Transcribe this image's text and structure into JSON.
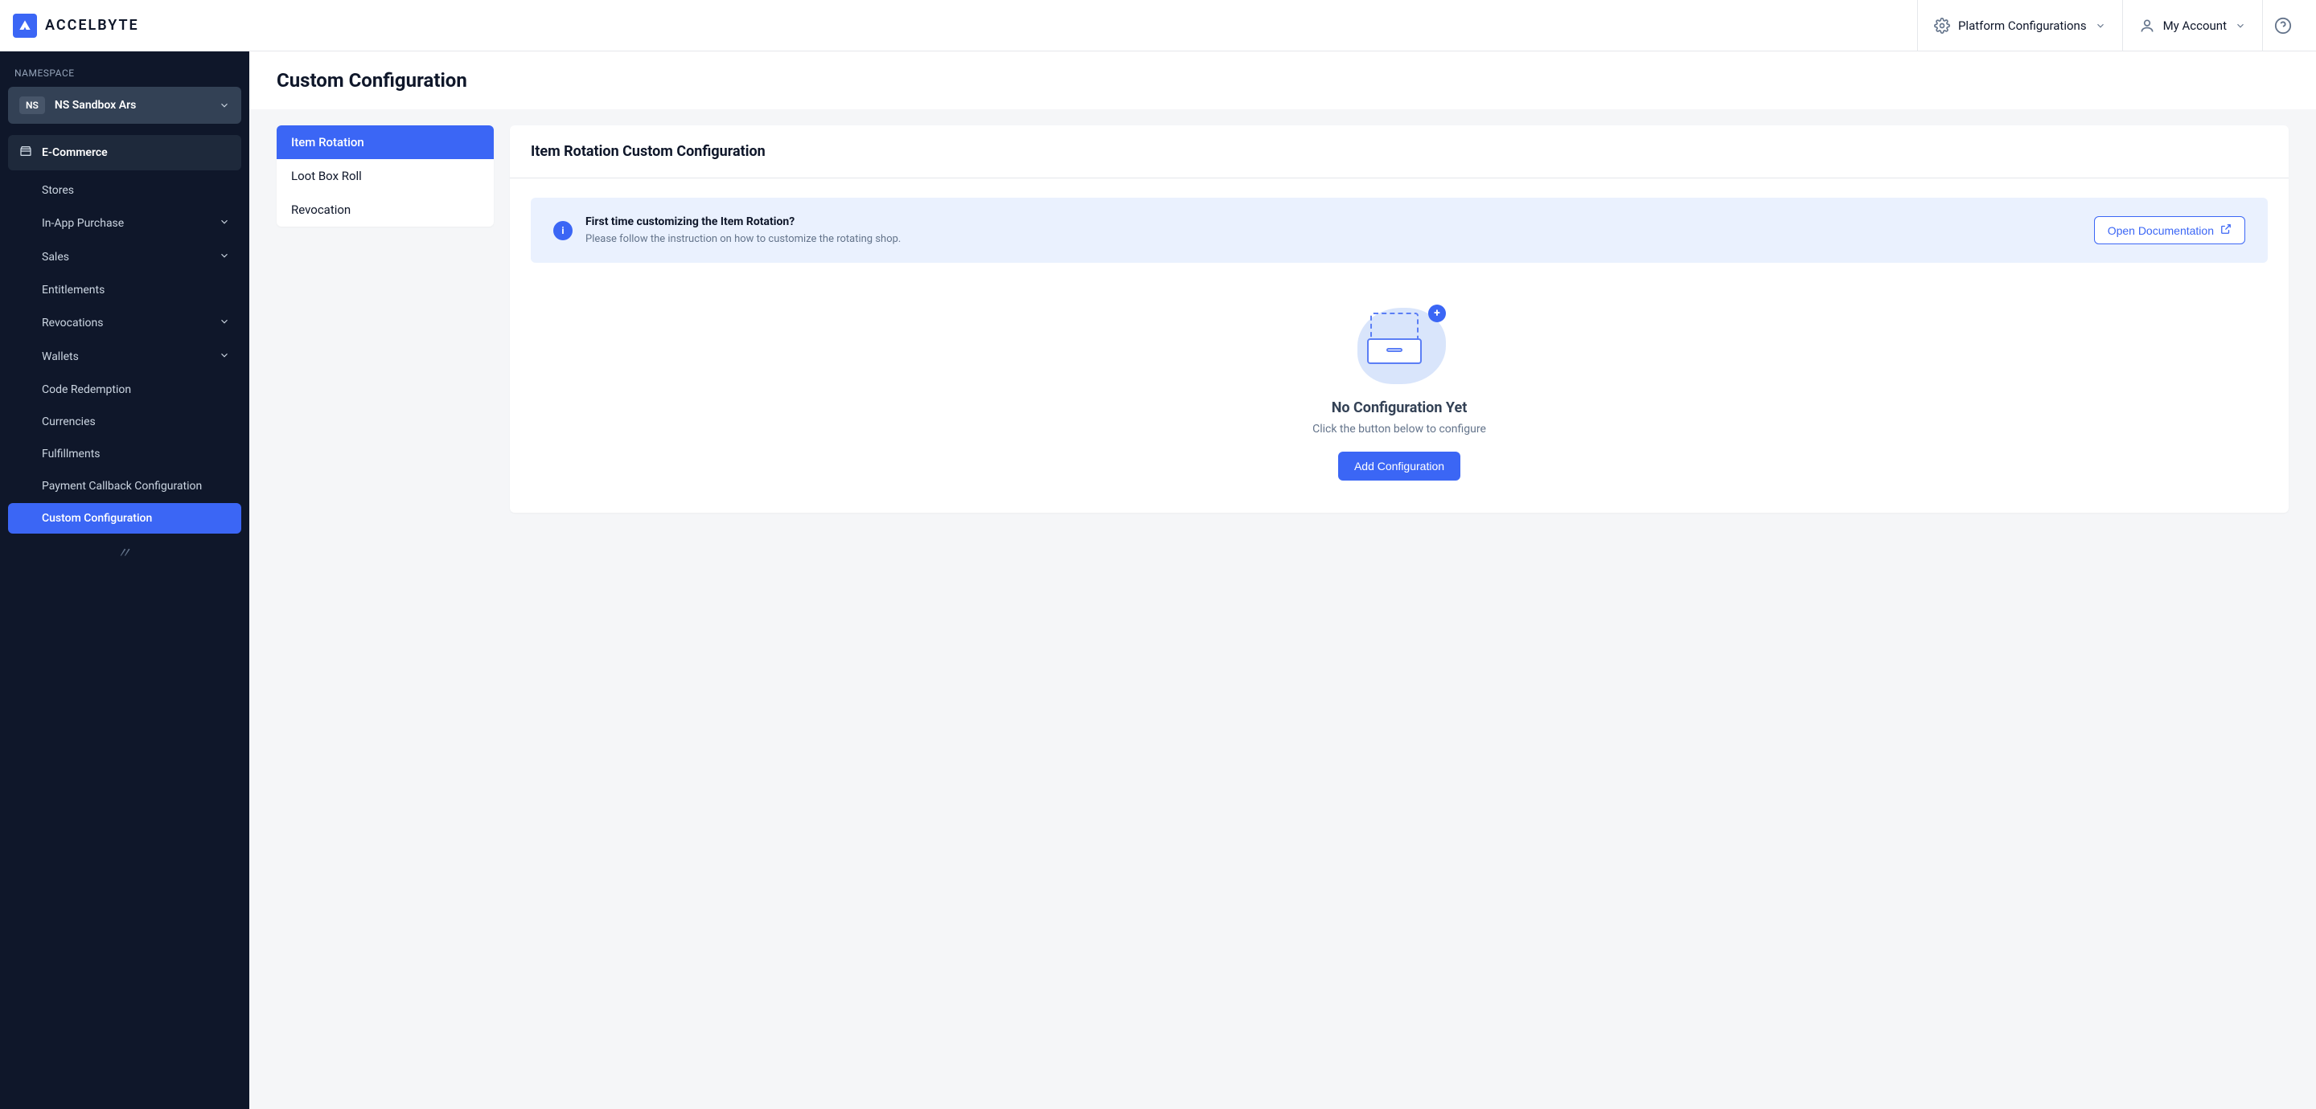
{
  "brand": "ACCELBYTE",
  "header": {
    "platform_config": "Platform Configurations",
    "account": "My Account"
  },
  "sidebar": {
    "ns_label": "NAMESPACE",
    "ns_badge": "NS",
    "ns_name": "NS Sandbox Ars",
    "section": "E-Commerce",
    "items": [
      {
        "label": "Stores",
        "expandable": false
      },
      {
        "label": "In-App Purchase",
        "expandable": true
      },
      {
        "label": "Sales",
        "expandable": true
      },
      {
        "label": "Entitlements",
        "expandable": false
      },
      {
        "label": "Revocations",
        "expandable": true
      },
      {
        "label": "Wallets",
        "expandable": true
      },
      {
        "label": "Code Redemption",
        "expandable": false
      },
      {
        "label": "Currencies",
        "expandable": false
      },
      {
        "label": "Fulfillments",
        "expandable": false
      },
      {
        "label": "Payment Callback Configuration",
        "expandable": false
      },
      {
        "label": "Custom Configuration",
        "expandable": false,
        "active": true
      }
    ]
  },
  "page": {
    "title": "Custom Configuration"
  },
  "subnav": [
    {
      "label": "Item Rotation",
      "active": true
    },
    {
      "label": "Loot Box Roll"
    },
    {
      "label": "Revocation"
    }
  ],
  "panel": {
    "title": "Item Rotation Custom Configuration",
    "info_heading": "First time customizing the Item Rotation?",
    "info_sub": "Please follow the instruction on how to customize the rotating shop.",
    "doc_btn": "Open Documentation",
    "empty_title": "No Configuration Yet",
    "empty_sub": "Click the button below to configure",
    "add_btn": "Add Configuration"
  }
}
